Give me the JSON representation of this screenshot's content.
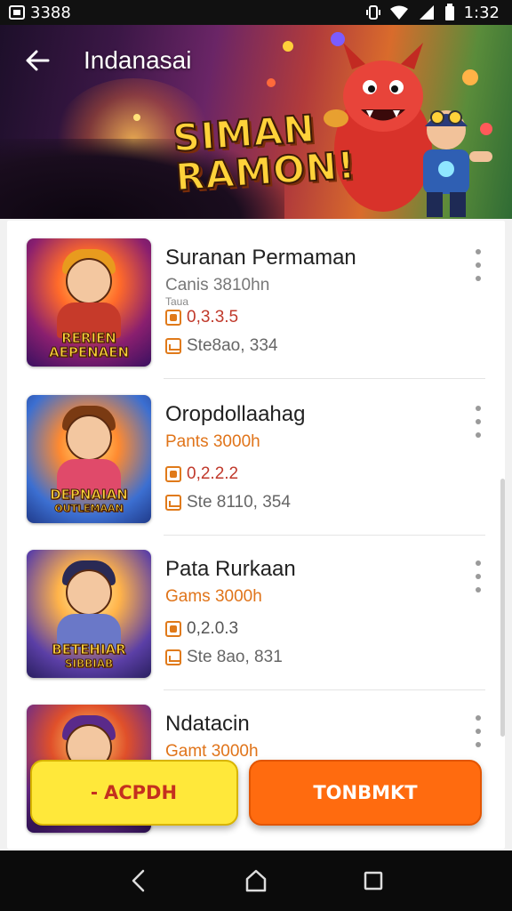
{
  "status_bar": {
    "left_text": "3388",
    "time": "1:32",
    "icons": [
      "notification-box-icon",
      "vibrate-icon",
      "wifi-icon",
      "signal-icon",
      "battery-icon"
    ]
  },
  "header": {
    "title": "Indanasai",
    "logo_lines": [
      "SIMAN",
      "RAMON!"
    ],
    "back_icon": "arrow-left-icon"
  },
  "games": [
    {
      "title": "Suranan Permaman",
      "subtitle": "Canis 3810hn",
      "tag": "Taua",
      "rating": "0,3.3.5",
      "size": "Ste8ao, 334",
      "thumb_caption": [
        "RERIEN",
        "AEPENAEN"
      ],
      "subtitle_style": "gray"
    },
    {
      "title": "Oropdollaahag",
      "subtitle": "Pants 3000h",
      "rating": "0,2.2.2",
      "size": "Ste 8110, 354",
      "thumb_caption": [
        "DEPNAIAN",
        "OUTLEMAAN"
      ],
      "subtitle_style": "orange"
    },
    {
      "title": "Pata Rurkaan",
      "subtitle": "Gams 3000h",
      "rating": "0,2.0.3",
      "size": "Ste 8ao, 831",
      "thumb_caption": [
        "BETEHIAR",
        "SIBBIAB"
      ],
      "subtitle_style": "orange"
    },
    {
      "title": "Ndatacin",
      "subtitle": "Gamt 3000h",
      "rating": "",
      "size": "",
      "thumb_caption": [],
      "subtitle_style": "orange"
    }
  ],
  "buttons": {
    "accept_label": "ACPDH",
    "primary_label": "TONBMKT"
  },
  "colors": {
    "accent_orange": "#ff6b0f",
    "accept_yellow": "#ffe83a",
    "rating_red": "#c0392b"
  }
}
